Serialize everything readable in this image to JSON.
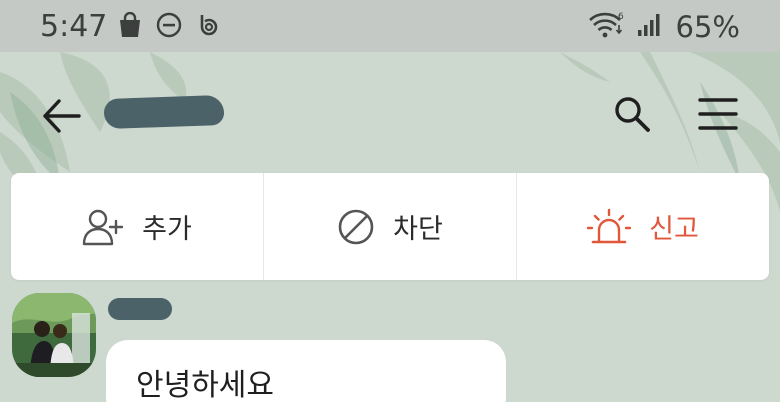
{
  "status_bar": {
    "time": "5:47",
    "battery": "65%",
    "left_icons": [
      "shopping-bag-icon",
      "do-not-disturb-icon",
      "b-app-icon"
    ],
    "right_icons": [
      "wifi-6-icon",
      "signal-icon"
    ]
  },
  "header": {
    "icons": [
      "arrow-left-icon",
      "search-icon",
      "hamburger-menu-icon"
    ]
  },
  "actions": {
    "add_label": "추가",
    "block_label": "차단",
    "report_label": "신고"
  },
  "message": {
    "text": "안녕하세요"
  },
  "colors": {
    "status_bar_bg": "#c4c9c6",
    "wallpaper": "#cdd8cf",
    "report_red": "#e0573b",
    "redaction": "#4b6269"
  }
}
